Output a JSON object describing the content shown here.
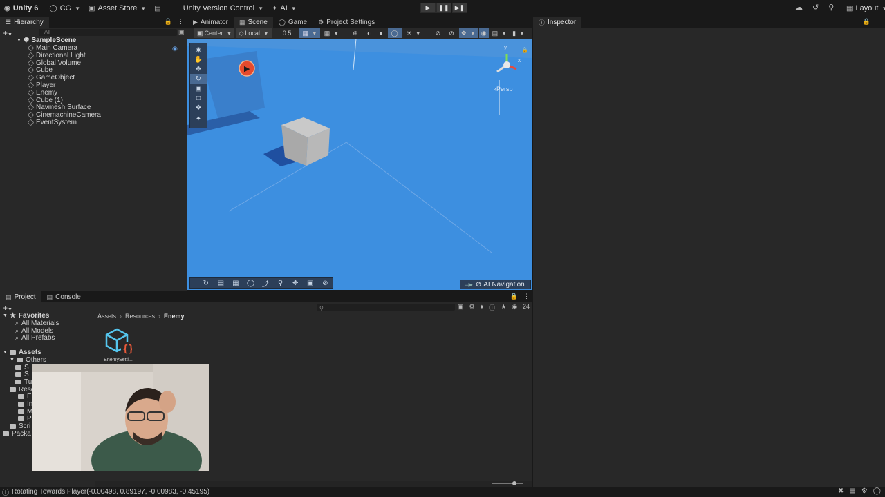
{
  "toolbar": {
    "app_label": "Unity 6",
    "account_label": "CG",
    "asset_store_label": "Asset Store",
    "version_control_label": "Unity Version Control",
    "ai_label": "AI",
    "layout_label": "Layout",
    "play_icon": "play-icon",
    "pause_icon": "pause-icon",
    "step_icon": "step-icon"
  },
  "hierarchy": {
    "tab_label": "Hierarchy",
    "search_placeholder": "All",
    "scene_name": "SampleScene",
    "items": [
      {
        "label": "Main Camera"
      },
      {
        "label": "Directional Light"
      },
      {
        "label": "Global Volume"
      },
      {
        "label": "Cube"
      },
      {
        "label": "GameObject"
      },
      {
        "label": "Player"
      },
      {
        "label": "Enemy"
      },
      {
        "label": "Cube (1)"
      },
      {
        "label": "Navmesh Surface"
      },
      {
        "label": "CinemachineCamera"
      },
      {
        "label": "EventSystem"
      }
    ]
  },
  "center_tabs": {
    "animator": "Animator",
    "scene": "Scene",
    "game": "Game",
    "project_settings": "Project Settings"
  },
  "scene_toolbar": {
    "pivot_label": "Center",
    "space_label": "Local",
    "snap_value": "0.5",
    "persp_label": "‹Persp",
    "gizmo_y": "y",
    "gizmo_x": "x",
    "overlay_label": "AI Navigation"
  },
  "inspector": {
    "tab_label": "Inspector"
  },
  "project": {
    "tab_label": "Project",
    "console_tab_label": "Console",
    "count_badge": "24",
    "breadcrumb": [
      "Assets",
      "Resources",
      "Enemy"
    ],
    "favorites_label": "Favorites",
    "favorites": [
      "All Materials",
      "All Models",
      "All Prefabs"
    ],
    "assets_label": "Assets",
    "others_label": "Others",
    "partial_rows": [
      "S",
      "S",
      "Tu",
      "Reso",
      "E",
      "In",
      "M",
      "P",
      "Scri",
      "Packa"
    ],
    "asset_file_label": "EnemySetti..."
  },
  "status": {
    "message": "Rotating Towards Player(-0.00498, 0.89197, -0.00983, -0.45195)"
  },
  "colors": {
    "sky": "#3d8fe0",
    "accent": "#4a90d9",
    "panel": "#282828",
    "bar": "#191919"
  }
}
